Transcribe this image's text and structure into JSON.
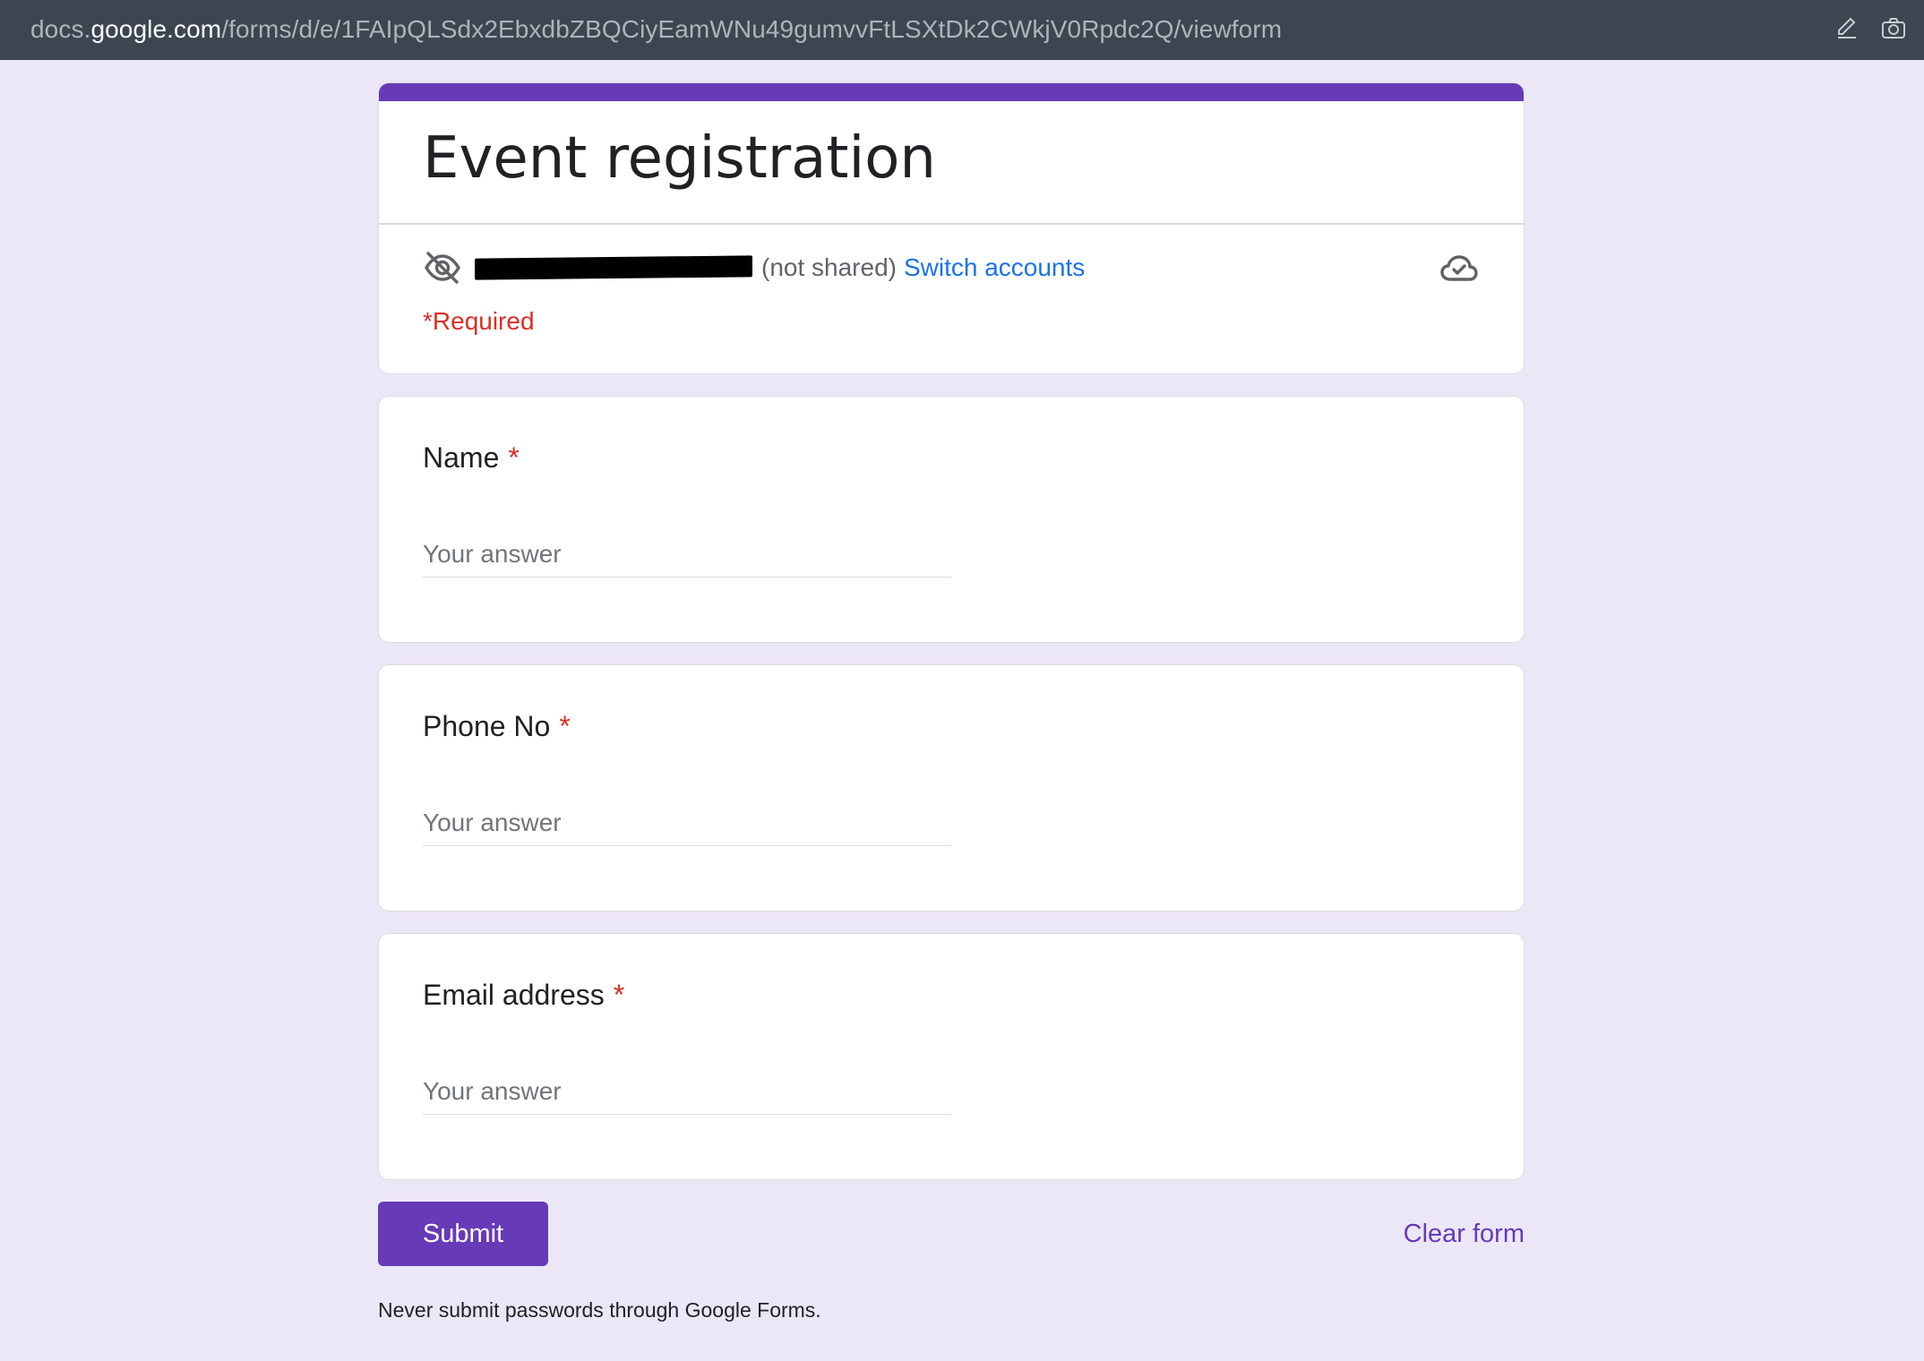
{
  "browser": {
    "url_prefix": "docs.",
    "url_host": "google.com",
    "url_path": "/forms/d/e/1FAIpQLSdx2EbxdbZBQCiyEamWNu49gumvvFtLSXtDk2CWkjV0Rpdc2Q/viewform",
    "actions": [
      {
        "icon": "pencil-edit-icon"
      },
      {
        "icon": "camera-icon"
      }
    ]
  },
  "form": {
    "accent_color": "#673ab7",
    "title": "Event registration",
    "account": {
      "email_redacted": true,
      "status": "(not shared)",
      "switch_label": "Switch accounts"
    },
    "required_note": "*Required",
    "questions": [
      {
        "label": "Name",
        "required_mark": "*",
        "placeholder": "Your answer",
        "value": ""
      },
      {
        "label": "Phone No",
        "required_mark": "*",
        "placeholder": "Your answer",
        "value": ""
      },
      {
        "label": "Email address",
        "required_mark": "*",
        "placeholder": "Your answer",
        "value": ""
      }
    ],
    "submit_label": "Submit",
    "clear_label": "Clear form",
    "password_warning": "Never submit passwords through Google Forms."
  },
  "colors": {
    "background": "#ece7f6",
    "required_red": "#d93025",
    "link_blue": "#1a73e8"
  }
}
